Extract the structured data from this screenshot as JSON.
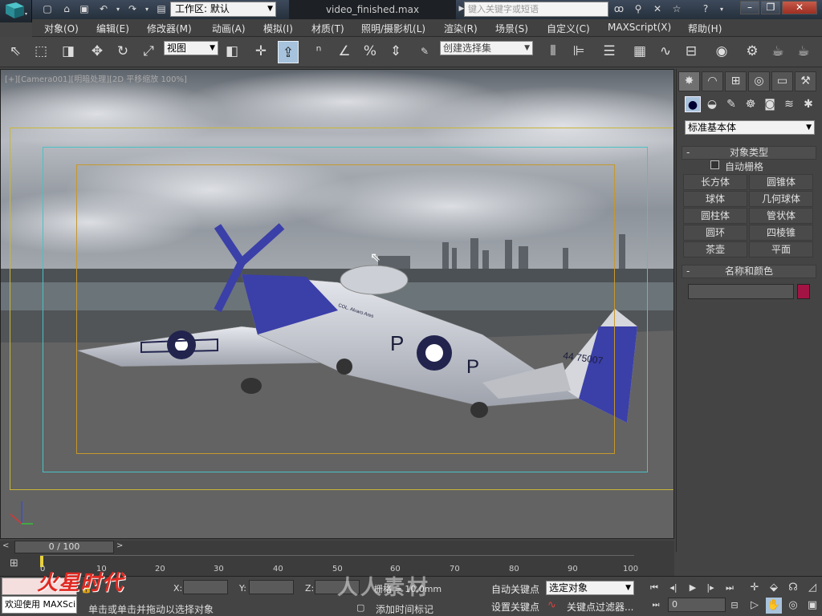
{
  "title": {
    "workspace": "工作区: 默认",
    "filename": "video_finished.max",
    "search_placeholder": "键入关键字或短语"
  },
  "menu": [
    "对象(O)",
    "编辑(E)",
    "修改器(M)",
    "动画(A)",
    "模拟(I)",
    "材质(T)",
    "照明/摄影机(L)",
    "渲染(R)",
    "场景(S)",
    "自定义(C)",
    "MAXScript(X)",
    "帮助(H)"
  ],
  "toolbar": {
    "view_select": "视图",
    "selection_set": "创建选择集"
  },
  "viewport": {
    "label": "[+][Camera001][明暗处理][2D 平移缩放 100%]",
    "plane_text": {
      "fuselage_tag": "P",
      "serial": "44 75007",
      "pilot": "COL. Alvaro Ares"
    }
  },
  "command_panel": {
    "category": "标准基本体",
    "object_type_header": "对象类型",
    "autogrid_label": "自动栅格",
    "autogrid_checked": false,
    "object_buttons": [
      "长方体",
      "圆锥体",
      "球体",
      "几何球体",
      "圆柱体",
      "管状体",
      "圆环",
      "四棱锥",
      "茶壶",
      "平面"
    ],
    "name_color_header": "名称和颜色",
    "object_color": "#a31444"
  },
  "timeline": {
    "frame_indicator": "0 / 100",
    "ticks": [
      "0",
      "10",
      "20",
      "30",
      "40",
      "50",
      "60",
      "70",
      "80",
      "90",
      "100"
    ]
  },
  "status": {
    "listener_text": "欢迎使用 MAXSci",
    "prompt": "单击或单击并拖动以选择对象",
    "x_label": "X:",
    "y_label": "Y:",
    "z_label": "Z:",
    "grid": "栅格 = 10.0mm",
    "add_time_tag": "添加时间标记",
    "auto_key": "自动关键点",
    "set_key": "设置关键点",
    "key_filter_label": "关键点过滤器...",
    "selected_object": "选定对象",
    "current_frame": "0"
  },
  "watermark": {
    "logo_text": "火星时代",
    "right_text": "人人素材"
  }
}
